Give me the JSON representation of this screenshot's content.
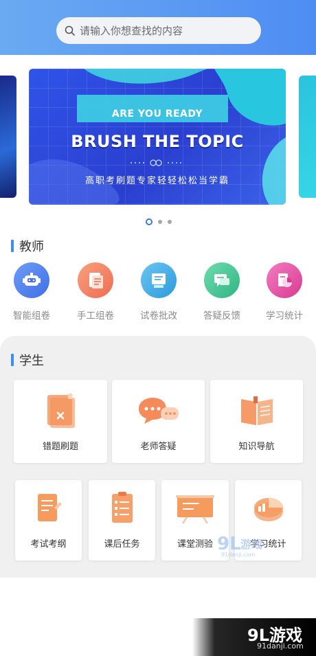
{
  "search": {
    "placeholder": "请输入你想查找的内容"
  },
  "banner": {
    "tagline": "ARE YOU READY",
    "title": "BRUSH THE TOPIC",
    "subtitle": "高职考刷题专家轻轻松松当学霸",
    "slide_count": 3,
    "active_slide": 1
  },
  "teacher": {
    "title": "教师",
    "items": [
      {
        "label": "智能组卷",
        "icon": "robot-icon",
        "color": "#4f7ff0"
      },
      {
        "label": "手工组卷",
        "icon": "document-icon",
        "color": "#f07a5a"
      },
      {
        "label": "试卷批改",
        "icon": "paper-grading-icon",
        "color": "#3aa9e0"
      },
      {
        "label": "答疑反馈",
        "icon": "chat-feedback-icon",
        "color": "#3cc48f"
      },
      {
        "label": "学习统计",
        "icon": "statistics-icon",
        "color": "#e4479c"
      }
    ]
  },
  "student": {
    "title": "学生",
    "row1": [
      {
        "label": "错题刷题",
        "icon": "wrong-questions-icon"
      },
      {
        "label": "老师答疑",
        "icon": "teacher-chat-icon"
      },
      {
        "label": "知识导航",
        "icon": "open-book-icon"
      }
    ],
    "row2": [
      {
        "label": "考试考纲",
        "icon": "exam-outline-icon"
      },
      {
        "label": "课后任务",
        "icon": "task-list-icon"
      },
      {
        "label": "课堂测验",
        "icon": "classroom-board-icon"
      },
      {
        "label": "学习统计",
        "icon": "pie-chart-icon"
      }
    ]
  },
  "watermark": {
    "brand": "9L游戏",
    "url": "91danji.com"
  },
  "colors": {
    "header": "#5a97f2",
    "accent": "#3c8ff0",
    "panel": "#f0f0f0"
  }
}
